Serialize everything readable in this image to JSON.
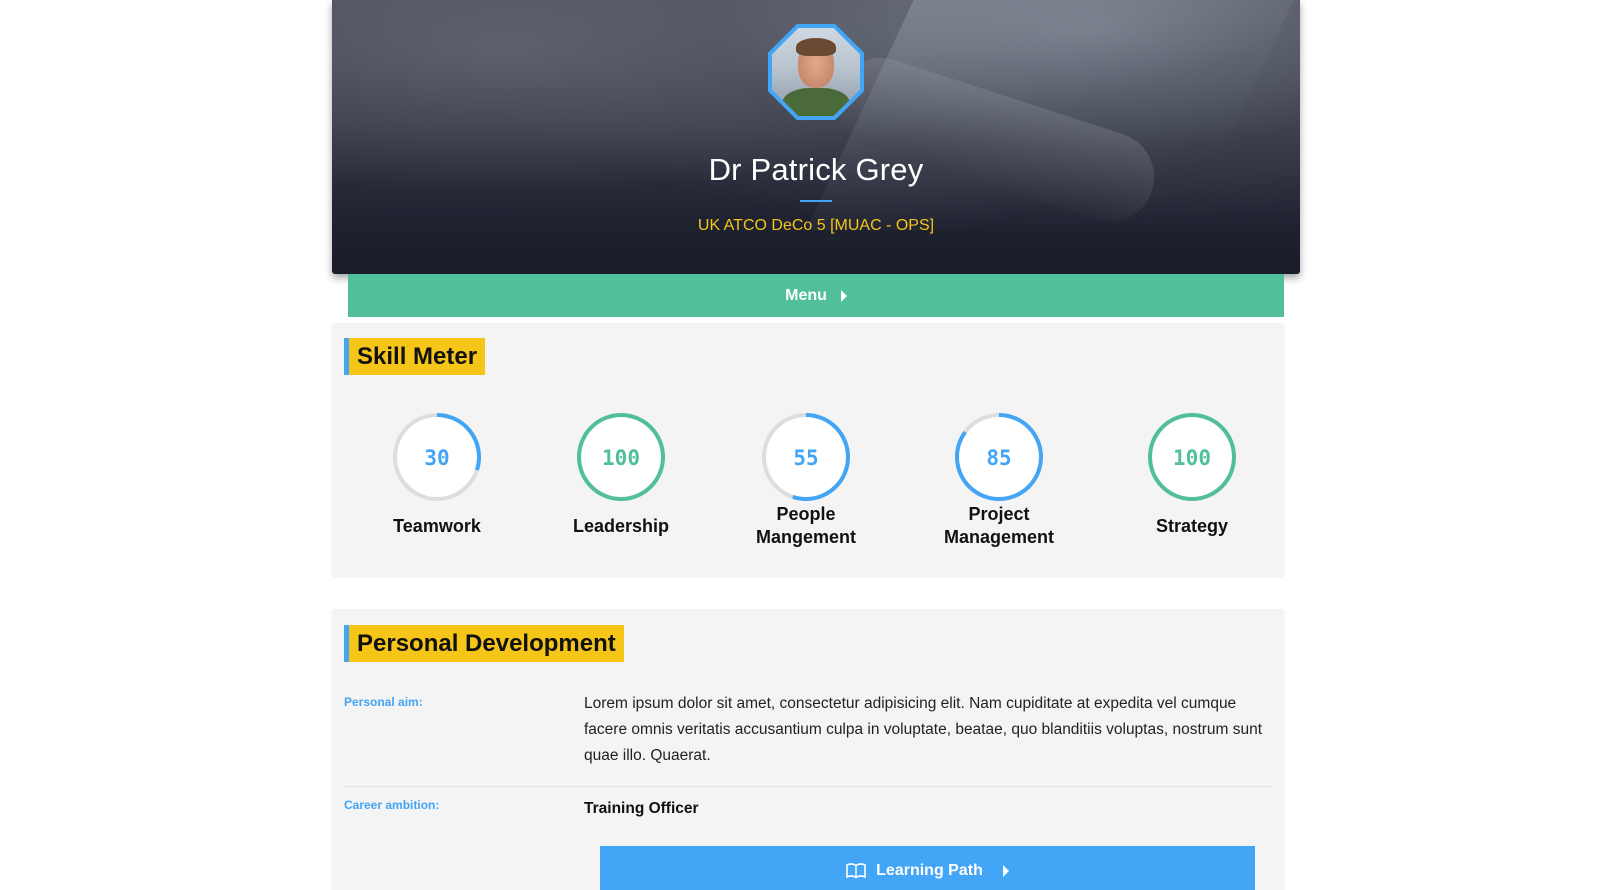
{
  "profile": {
    "name": "Dr Patrick Grey",
    "subtitle": "UK ATCO DeCo 5 [MUAC - OPS]",
    "avatar_icon": "user-photo"
  },
  "menu": {
    "label": "Menu",
    "icon": "caret-right-icon"
  },
  "skills": {
    "title": "Skill Meter",
    "items": [
      {
        "value": "30",
        "label": "Teamwork",
        "percent": 30,
        "color": "#42a5f5"
      },
      {
        "value": "100",
        "label": "Leadership",
        "percent": 100,
        "color": "#51bf9b"
      },
      {
        "value": "55",
        "label": "People Mangement",
        "percent": 55,
        "color": "#42a5f5"
      },
      {
        "value": "85",
        "label": "Project Management",
        "percent": 85,
        "color": "#42a5f5"
      },
      {
        "value": "100",
        "label": "Strategy",
        "percent": 100,
        "color": "#51bf9b"
      }
    ],
    "track_color": "#dddddd"
  },
  "development": {
    "title": "Personal Development",
    "aim_label": "Personal aim:",
    "aim_text": "Lorem ipsum dolor sit amet, consectetur adipisicing elit. Nam cupiditate at expedita vel cumque facere omnis veritatis accusantium culpa in voluptate, beatae, quo blanditiis voluptas, nostrum sunt quae illo. Quaerat.",
    "ambition_label": "Career ambition:",
    "ambition_text": "Training Officer",
    "learning_button": "Learning Path",
    "learning_icon": "book-icon"
  },
  "colors": {
    "accent_blue": "#42a5f5",
    "accent_green": "#51bf9b",
    "accent_yellow": "#f5c518"
  }
}
